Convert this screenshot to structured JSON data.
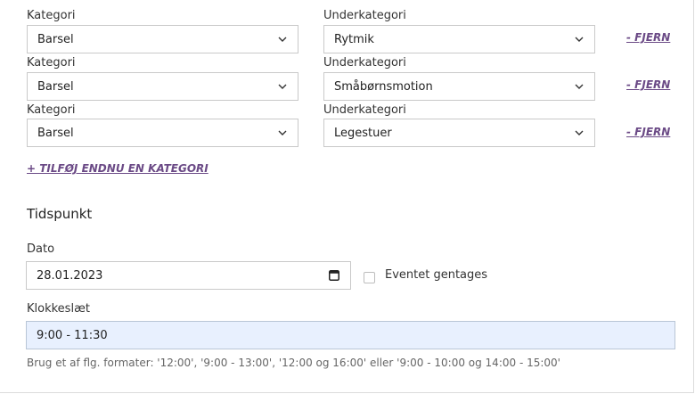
{
  "category_rows": [
    {
      "category_label": "Kategori",
      "category_value": "Barsel",
      "sub_label": "Underkategori",
      "sub_value": "Rytmik",
      "remove_label": "- FJERN"
    },
    {
      "category_label": "Kategori",
      "category_value": "Barsel",
      "sub_label": "Underkategori",
      "sub_value": "Småbørnsmotion",
      "remove_label": "- FJERN"
    },
    {
      "category_label": "Kategori",
      "category_value": "Barsel",
      "sub_label": "Underkategori",
      "sub_value": "Legestuer",
      "remove_label": "- FJERN"
    }
  ],
  "add_category_label": "+ TILFØJ ENDNU EN KATEGORI",
  "time_section": {
    "heading": "Tidspunkt",
    "date_label": "Dato",
    "date_value": "28.01.2023",
    "repeat_label": "Eventet gentages",
    "time_label": "Klokkeslæt",
    "time_value": "9:00 - 11:30",
    "hint": "Brug et af flg. formater: '12:00', '9:00 - 13:00', '12:00 og 16:00' eller '9:00 - 10:00 og 14:00 - 15:00'"
  },
  "colors": {
    "link": "#6b4a86",
    "autofill": "#e8f0fe"
  }
}
